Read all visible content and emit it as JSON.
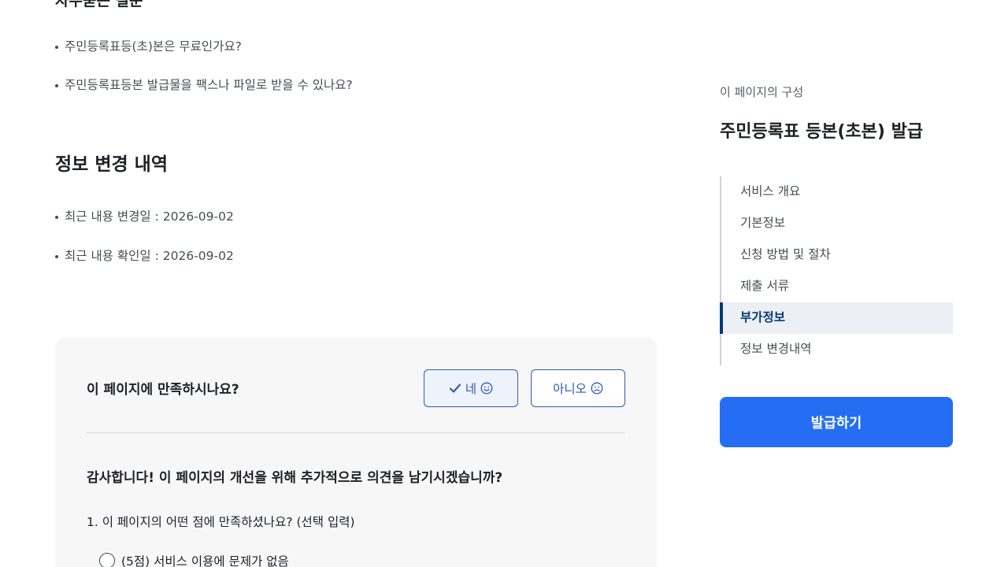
{
  "faq": {
    "heading": "자주묻는 질문",
    "items": [
      "주민등록표등(초)본은 무료인가요?",
      "주민등록표등본 발급물을 팩스나 파일로 받을 수 있나요?"
    ]
  },
  "updates": {
    "title": "정보 변경 내역",
    "items": [
      "최근 내용 변경일 : 2026-09-02",
      "최근 내용 확인일 : 2026-09-02"
    ]
  },
  "feedback": {
    "question": "이 페이지에 만족하시나요?",
    "yes_label": "네",
    "no_label": "아니오",
    "thanks_text": "감사합니다! 이 페이지의 개선을 위해 추가적으로 의견을 남기시겠습니까?",
    "q1": "1. 이 페이지의 어떤 점에 만족하셨나요? (선택 입력)",
    "option1": "(5점) 서비스 이용에 문제가 없음"
  },
  "toc": {
    "label": "이 페이지의 구성",
    "title": "주민등록표 등본(초본) 발급",
    "items": [
      "서비스 개요",
      "기본정보",
      "신청 방법 및 절차",
      "제출 서류",
      "부가정보",
      "정보 변경내역"
    ],
    "active_index": 4
  },
  "apply_button": "발급하기",
  "colors": {
    "primary": "#256ef4",
    "active_nav": "#063a74",
    "button_border": "#2e5bb5"
  }
}
